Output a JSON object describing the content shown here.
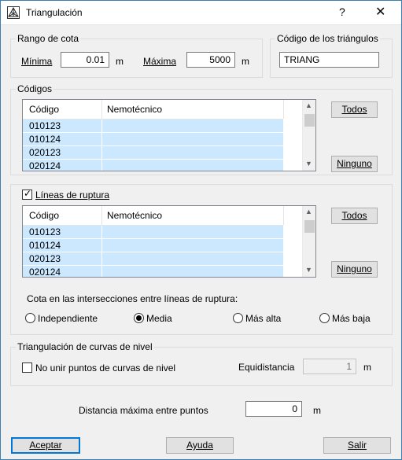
{
  "window": {
    "title": "Triangulación",
    "help_glyph": "?",
    "close_glyph": "✕",
    "icon": "triangulation-app-icon"
  },
  "rango_cota": {
    "title": "Rango de cota",
    "min_label": "Mínima",
    "min_value": "0.01",
    "min_unit": "m",
    "max_label": "Máxima",
    "max_value": "5000",
    "max_unit": "m"
  },
  "codigo_triangulos": {
    "title": "Código de los triángulos",
    "value": "TRIANG"
  },
  "codigos": {
    "title": "Códigos",
    "col_codigo": "Código",
    "col_nemotecnico": "Nemotécnico",
    "rows": [
      {
        "codigo": "010123",
        "nemotecnico": ""
      },
      {
        "codigo": "010124",
        "nemotecnico": ""
      },
      {
        "codigo": "020123",
        "nemotecnico": ""
      },
      {
        "codigo": "020124",
        "nemotecnico": ""
      }
    ],
    "todos_label": "Todos",
    "ninguno_label": "Ninguno"
  },
  "lineas_ruptura": {
    "checkbox_label": "Líneas de ruptura",
    "checked": true,
    "col_codigo": "Código",
    "col_nemotecnico": "Nemotécnico",
    "rows": [
      {
        "codigo": "010123",
        "nemotecnico": ""
      },
      {
        "codigo": "010124",
        "nemotecnico": ""
      },
      {
        "codigo": "020123",
        "nemotecnico": ""
      },
      {
        "codigo": "020124",
        "nemotecnico": ""
      }
    ],
    "todos_label": "Todos",
    "ninguno_label": "Ninguno",
    "cota_label": "Cota en las intersecciones entre líneas de ruptura:",
    "options": [
      {
        "label": "Independiente",
        "selected": false
      },
      {
        "label": "Media",
        "selected": true
      },
      {
        "label": "Más alta",
        "selected": false
      },
      {
        "label": "Más baja",
        "selected": false
      }
    ]
  },
  "curvas_nivel": {
    "title": "Triangulación de curvas de nivel",
    "no_unir_label": "No unir puntos de curvas de nivel",
    "no_unir_checked": false,
    "equidistancia_label": "Equidistancia",
    "equidistancia_value": "1",
    "equidistancia_unit": "m"
  },
  "distancia": {
    "label": "Distancia máxima entre puntos",
    "value": "0",
    "unit": "m"
  },
  "buttons": {
    "aceptar": "Aceptar",
    "ayuda": "Ayuda",
    "salir": "Salir"
  }
}
